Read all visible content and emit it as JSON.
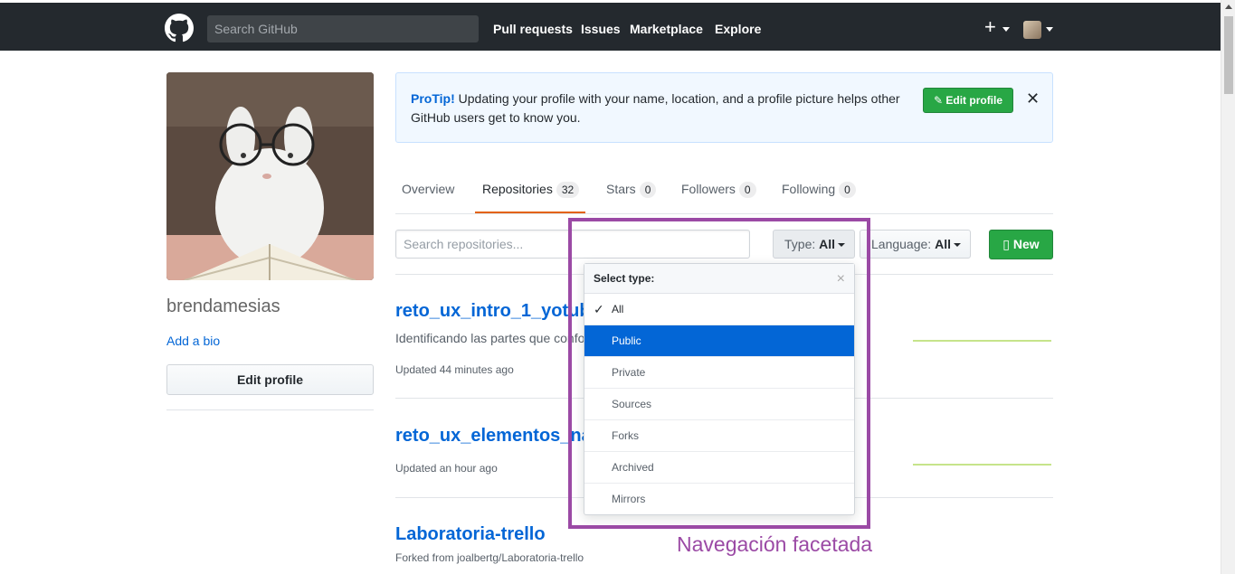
{
  "header": {
    "search_placeholder": "Search GitHub",
    "nav": [
      "Pull requests",
      "Issues",
      "Marketplace",
      "Explore"
    ],
    "plus": "+"
  },
  "profile": {
    "username": "brendamesias",
    "add_bio": "Add a bio",
    "edit_profile": "Edit profile"
  },
  "protip": {
    "label": "ProTip!",
    "text": "Updating your profile with your name, location, and a profile picture helps other GitHub users get to know you.",
    "button": "Edit profile",
    "close": "✕"
  },
  "tabs": [
    {
      "label": "Overview",
      "count": null
    },
    {
      "label": "Repositories",
      "count": "32"
    },
    {
      "label": "Stars",
      "count": "0"
    },
    {
      "label": "Followers",
      "count": "0"
    },
    {
      "label": "Following",
      "count": "0"
    }
  ],
  "filters": {
    "search_placeholder": "Search repositories...",
    "type_label": "Type:",
    "type_value": "All",
    "language_label": "Language:",
    "language_value": "All",
    "new_button": "New"
  },
  "dropdown": {
    "title": "Select type:",
    "close": "×",
    "items": [
      "All",
      "Public",
      "Private",
      "Sources",
      "Forks",
      "Archived",
      "Mirrors"
    ],
    "selected": "All",
    "highlighted": "Public"
  },
  "repos": [
    {
      "name": "reto_ux_intro_1_yotubu",
      "desc": "Identificando las partes que confo",
      "meta": "Updated 44 minutes ago"
    },
    {
      "name": "reto_ux_elementos_nav",
      "desc": "",
      "meta": "Updated an hour ago"
    },
    {
      "name": "Laboratoria-trello",
      "desc": "",
      "meta": "Forked from joalbertg/Laboratoria-trello"
    }
  ],
  "annotation": {
    "label": "Navegación facetada",
    "color": "#9b4aa5"
  },
  "colors": {
    "header_bg": "#24292e",
    "link": "#0366d6",
    "green": "#28a745",
    "tab_accent": "#e36209"
  }
}
